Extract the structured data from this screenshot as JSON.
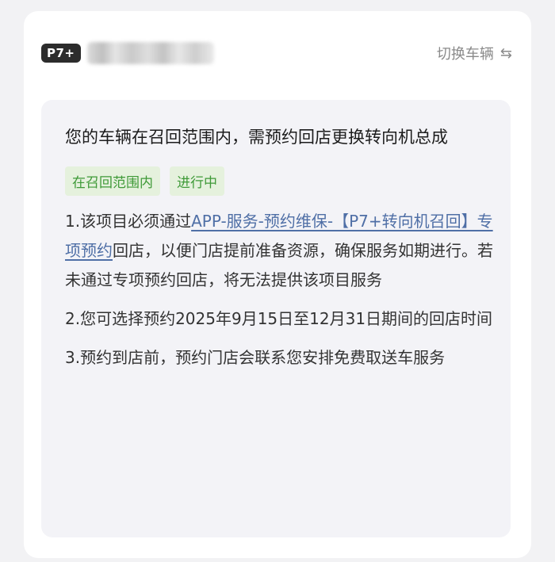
{
  "header": {
    "model_badge": "P7+",
    "switch_label": "切换车辆",
    "switch_icon": "swap-arrows-icon"
  },
  "notice": {
    "title": "您的车辆在召回范围内，需预约回店更换转向机总成",
    "tags": [
      "在召回范围内",
      "进行中"
    ],
    "item1_prefix": "1.该项目必须通过",
    "item1_link": "APP-服务-预约维保-【P7+转向机召回】专项预约",
    "item1_suffix": "回店，以便门店提前准备资源，确保服务如期进行。若未通过专项预约回店，将无法提供该项目服务",
    "item2": "2.您可选择预约2025年9月15日至12月31日期间的回店时间",
    "item3": "3.预约到店前，预约门店会联系您安排免费取送车服务"
  },
  "colors": {
    "tag_bg": "#e5f1dd",
    "tag_text": "#3f9a38",
    "link": "#4f6fa6"
  }
}
